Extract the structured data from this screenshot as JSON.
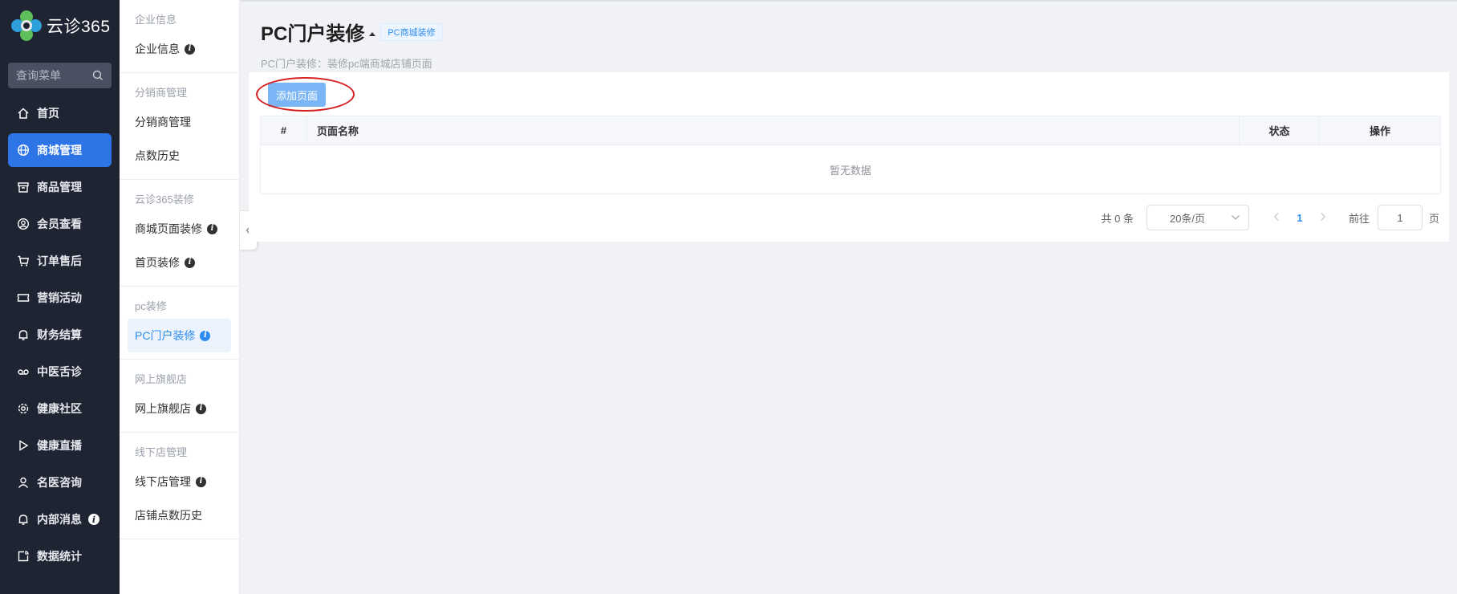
{
  "nav": {
    "logo_text": "云诊365",
    "search_placeholder": "查询菜单",
    "items": [
      {
        "label": "首页",
        "icon": "home-icon"
      },
      {
        "label": "商城管理",
        "icon": "globe-icon",
        "active": true
      },
      {
        "label": "商品管理",
        "icon": "box-icon"
      },
      {
        "label": "会员查看",
        "icon": "user-circle-icon"
      },
      {
        "label": "订单售后",
        "icon": "cart-icon"
      },
      {
        "label": "营销活动",
        "icon": "ticket-icon"
      },
      {
        "label": "财务结算",
        "icon": "bell-icon"
      },
      {
        "label": "中医舌诊",
        "icon": "tape-icon"
      },
      {
        "label": "健康社区",
        "icon": "gear-icon"
      },
      {
        "label": "健康直播",
        "icon": "play-icon"
      },
      {
        "label": "名医咨询",
        "icon": "user-icon"
      },
      {
        "label": "内部消息",
        "icon": "bell-icon",
        "info": "i"
      },
      {
        "label": "数据统计",
        "icon": "chart-icon"
      }
    ]
  },
  "subnav": {
    "groups": [
      {
        "title": "企业信息",
        "items": [
          {
            "label": "企业信息",
            "info": "i"
          }
        ]
      },
      {
        "title": "分销商管理",
        "items": [
          {
            "label": "分销商管理"
          },
          {
            "label": "点数历史"
          }
        ]
      },
      {
        "title": "云诊365装修",
        "items": [
          {
            "label": "商城页面装修",
            "info": "i"
          },
          {
            "label": "首页装修",
            "info": "i"
          }
        ]
      },
      {
        "title": "pc装修",
        "items": [
          {
            "label": "PC门户装修",
            "info": "i",
            "active": true
          }
        ]
      },
      {
        "title": "网上旗舰店",
        "items": [
          {
            "label": "网上旗舰店",
            "info": "i"
          }
        ]
      },
      {
        "title": "线下店管理",
        "items": [
          {
            "label": "线下店管理",
            "info": "i"
          },
          {
            "label": "店铺点数历史"
          }
        ]
      }
    ]
  },
  "page": {
    "title": "PC门户装修",
    "tag": "PC商城装修",
    "subtitle": "PC门户装修：装修pc端商城店铺页面",
    "add_button": "添加页面"
  },
  "table": {
    "columns": [
      "#",
      "页面名称",
      "状态",
      "操作"
    ],
    "empty_text": "暂无数据"
  },
  "pager": {
    "total": "共 0 条",
    "page_size": "20条/页",
    "current_page": "1",
    "goto_label": "前往",
    "goto_value": "1",
    "goto_unit": "页"
  },
  "colors": {
    "nav_bg": "#1f2433",
    "nav_active": "#2d74e6",
    "accent": "#2d8cf0",
    "add_button": "#7ab5f5",
    "annotation": "#d42020"
  }
}
